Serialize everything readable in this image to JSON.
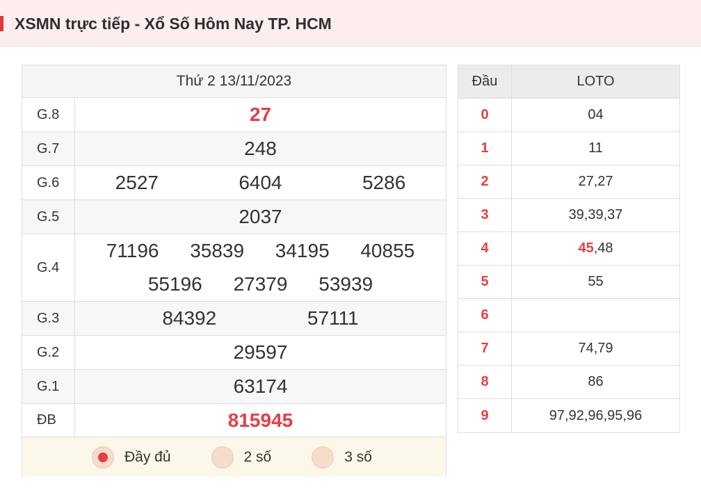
{
  "page": {
    "title": "XSMN trực tiếp - Xổ Số Hôm Nay TP. HCM"
  },
  "results": {
    "date": "Thứ 2 13/11/2023",
    "prizes": [
      {
        "label": "G.8",
        "numbers": [
          "27"
        ],
        "highlight": true
      },
      {
        "label": "G.7",
        "numbers": [
          "248"
        ]
      },
      {
        "label": "G.6",
        "numbers": [
          "2527",
          "6404",
          "5286"
        ]
      },
      {
        "label": "G.5",
        "numbers": [
          "2037"
        ]
      },
      {
        "label": "G.4",
        "numbers": [
          "71196",
          "35839",
          "34195",
          "40855",
          "55196",
          "27379",
          "53939"
        ]
      },
      {
        "label": "G.3",
        "numbers": [
          "84392",
          "57111"
        ]
      },
      {
        "label": "G.2",
        "numbers": [
          "29597"
        ]
      },
      {
        "label": "G.1",
        "numbers": [
          "63174"
        ]
      },
      {
        "label": "ĐB",
        "numbers": [
          "815945"
        ],
        "highlight": true
      }
    ],
    "options": [
      {
        "label": "Đầy đủ",
        "selected": true
      },
      {
        "label": "2 số",
        "selected": false
      },
      {
        "label": "3 số",
        "selected": false
      }
    ]
  },
  "loto": {
    "header_dau": "Đầu",
    "header_loto": "LOTO",
    "rows": [
      {
        "dau": "0",
        "values": "04"
      },
      {
        "dau": "1",
        "values": "11"
      },
      {
        "dau": "2",
        "values": "27,27"
      },
      {
        "dau": "3",
        "values": "39,39,37"
      },
      {
        "dau": "4",
        "highlight": "45",
        "rest": ",48"
      },
      {
        "dau": "5",
        "values": "55"
      },
      {
        "dau": "6",
        "values": ""
      },
      {
        "dau": "7",
        "values": "74,79"
      },
      {
        "dau": "8",
        "values": "86"
      },
      {
        "dau": "9",
        "values": "97,92,96,95,96"
      }
    ]
  },
  "colors": {
    "accent": "#e53e45",
    "header_bg": "#fdeeee",
    "footer_bg": "#fbf8ea"
  }
}
